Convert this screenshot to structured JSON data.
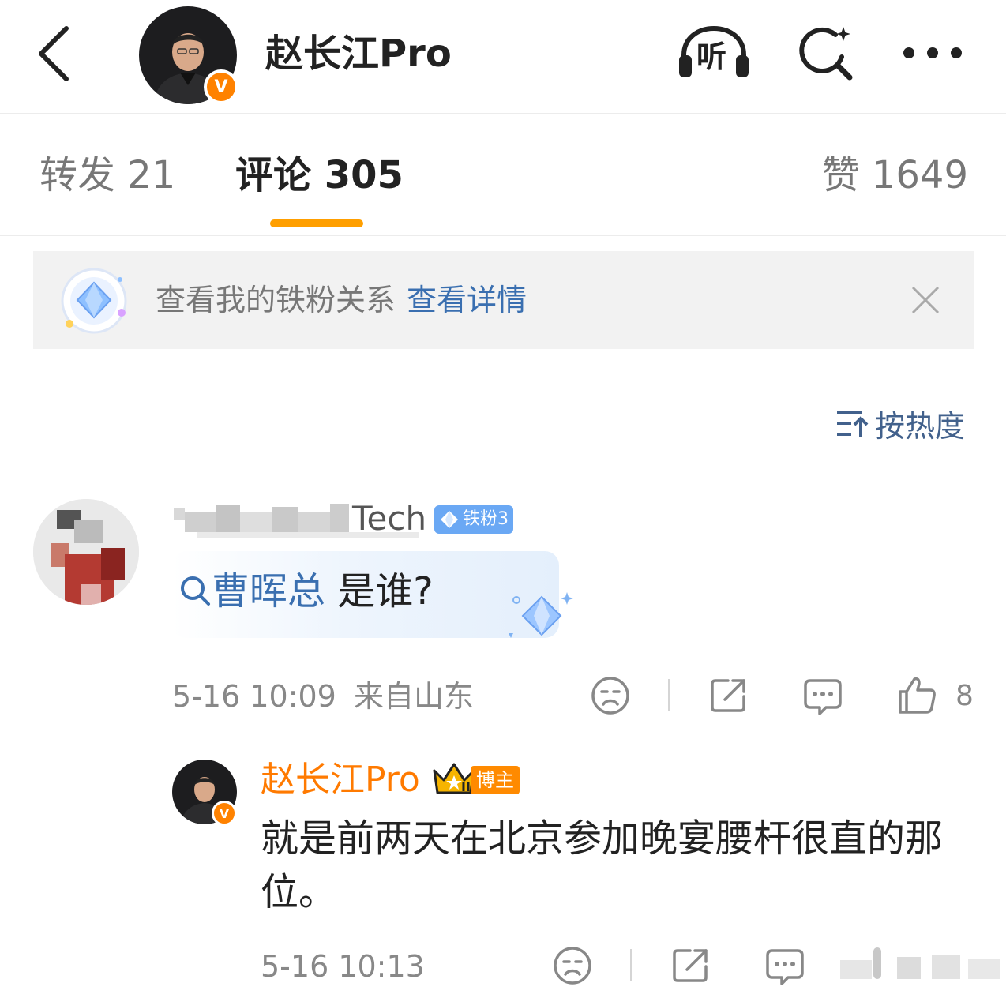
{
  "header": {
    "title": "赵长江Pro",
    "verified_badge": "V",
    "listen_label": "听"
  },
  "tabs": {
    "repost": "转发 21",
    "comment": "评论 305",
    "like": "赞 1649",
    "active_color": "#ff9f00"
  },
  "fan_banner": {
    "text": "查看我的铁粉关系",
    "link": "查看详情"
  },
  "sort": {
    "label": "按热度"
  },
  "comment": {
    "username_visible": "Tech",
    "fan_badge": "铁粉3",
    "topic": "曹晖总",
    "text": " 是谁?",
    "time": "5-16 10:09",
    "location": "来自山东",
    "like_count": "8"
  },
  "reply": {
    "username": "赵长江Pro",
    "badge": "博主",
    "crown_level": "II",
    "verified_badge": "V",
    "text": "就是前两天在北京参加晚宴腰杆很直的那位。",
    "time": "5-16 10:13"
  },
  "colors": {
    "accent_orange": "#ff8200",
    "link_blue": "#3a6fb0",
    "fan_badge_blue": "#6aa8f4"
  }
}
